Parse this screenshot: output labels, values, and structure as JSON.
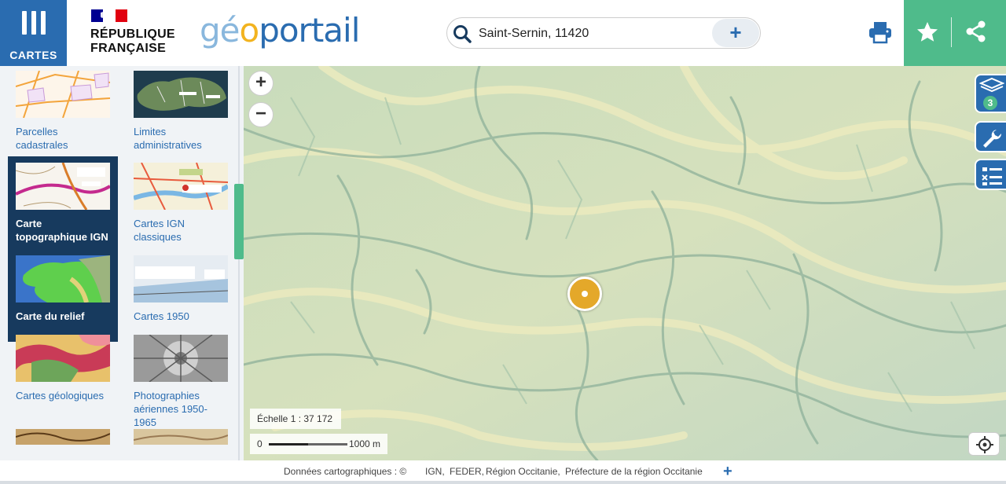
{
  "header": {
    "menu_label": "CARTES",
    "rf_line1": "RÉPUBLIQUE",
    "rf_line2": "FRANÇAISE",
    "logo_part1": "gé",
    "logo_part2": "o",
    "logo_part3": "portail",
    "print_icon": "printer-icon",
    "favorite_icon": "star-icon",
    "share_icon": "share-icon"
  },
  "search": {
    "value": "Saint-Sernin, 11420",
    "plus_label": "+"
  },
  "panel": {
    "cards": [
      {
        "name": "Parcelles cadastrales",
        "thumb": "cadastre-thumb",
        "active": false
      },
      {
        "name": "Limites administratives",
        "thumb": "admin-limits-thumb",
        "active": false
      },
      {
        "name": "Carte topographique IGN",
        "thumb": "topo-thumb",
        "active": true
      },
      {
        "name": "Cartes IGN classiques",
        "thumb": "classic-map-thumb",
        "active": false
      },
      {
        "name": "Carte du relief",
        "thumb": "relief-thumb",
        "active": true
      },
      {
        "name": "Cartes 1950",
        "thumb": "map-1950-thumb",
        "active": false
      },
      {
        "name": "Cartes géologiques",
        "thumb": "geology-thumb",
        "active": false
      },
      {
        "name": "Photographies aériennes 1950-1965",
        "thumb": "aerial-photo-thumb",
        "active": false
      }
    ]
  },
  "map": {
    "zoom_in": "+",
    "zoom_out": "−",
    "layer_count": "3",
    "scale_text": "Échelle 1 :  37 172",
    "scalebar_zero": "0",
    "scalebar_distance": "1000 m",
    "colors": {
      "terrain_light": "#e6e5b5",
      "terrain_mid": "#c4d8b8",
      "marker": "#e4a82a"
    }
  },
  "footer": {
    "data_label": "Données cartographiques : ©",
    "credits": [
      "IGN,",
      "FEDER,",
      "Région Occitanie,",
      "Préfecture de la région Occitanie"
    ],
    "plus_label": "+"
  },
  "colors": {
    "brand_blue": "#2a6cb0",
    "brand_green": "#4fbb8b",
    "panel_bg": "#f0f3f6",
    "active_card": "#173a5e"
  }
}
